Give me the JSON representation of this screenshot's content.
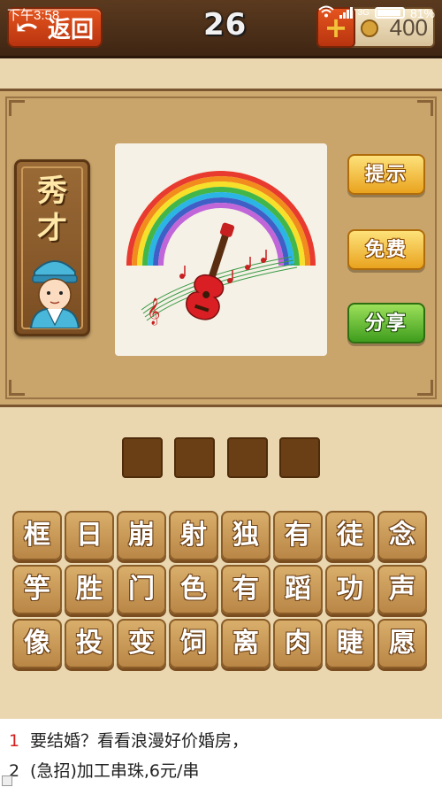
{
  "status_bar": {
    "time": "下午3:58",
    "network": "3G",
    "battery": "81%"
  },
  "header": {
    "back_label": "返回",
    "level": "26",
    "coins": "400",
    "add_label": "+"
  },
  "hint_card": {
    "text_line1": "秀",
    "text_line2": "才"
  },
  "side_buttons": {
    "hint": "提示",
    "free": "免费",
    "share": "分享"
  },
  "answer_slots": 4,
  "tiles": [
    [
      "框",
      "日",
      "崩",
      "射",
      "独",
      "有",
      "徒",
      "念"
    ],
    [
      "竽",
      "胜",
      "门",
      "色",
      "有",
      "蹈",
      "功",
      "声"
    ],
    [
      "像",
      "投",
      "变",
      "饲",
      "离",
      "肉",
      "睫",
      "愿"
    ]
  ],
  "ads": [
    {
      "num": "1",
      "text": "要结婚？看看浪漫好价婚房，"
    },
    {
      "num": "2",
      "text": "(急招)加工串珠,6元/串"
    }
  ],
  "colors": {
    "accent_orange": "#e4541e",
    "board": "#cda86f",
    "tile": "#c99a58"
  }
}
